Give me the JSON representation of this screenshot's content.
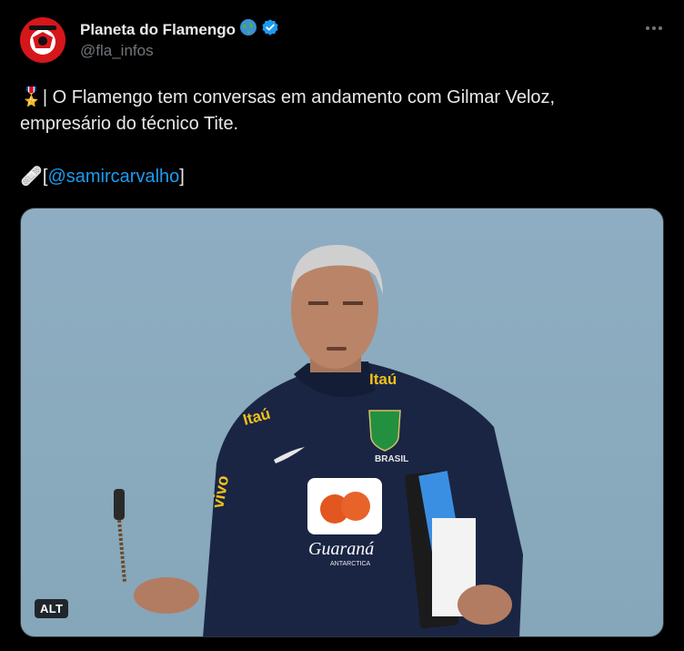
{
  "author": {
    "display_name": "Planeta do Flamengo",
    "handle": "@fla_infos",
    "badges": [
      "globe-icon",
      "verified-icon"
    ]
  },
  "tweet": {
    "line1_prefix": "🎖️| ",
    "line1": "O Flamengo tem conversas em andamento com Gilmar Veloz,",
    "line2": "empresário do técnico Tite.",
    "source_prefix": "🩹[",
    "mention": "@samircarvalho",
    "source_suffix": "]"
  },
  "media": {
    "alt_label": "ALT",
    "description_marks": [
      "Itaú",
      "Itaú",
      "vivo",
      "BRASIL",
      "Guaraná",
      "ANTARCTICA"
    ]
  },
  "colors": {
    "background": "#000000",
    "text": "#e7e9ea",
    "secondary": "#71767b",
    "link": "#1d9bf0",
    "verified": "#1d9bf0"
  }
}
